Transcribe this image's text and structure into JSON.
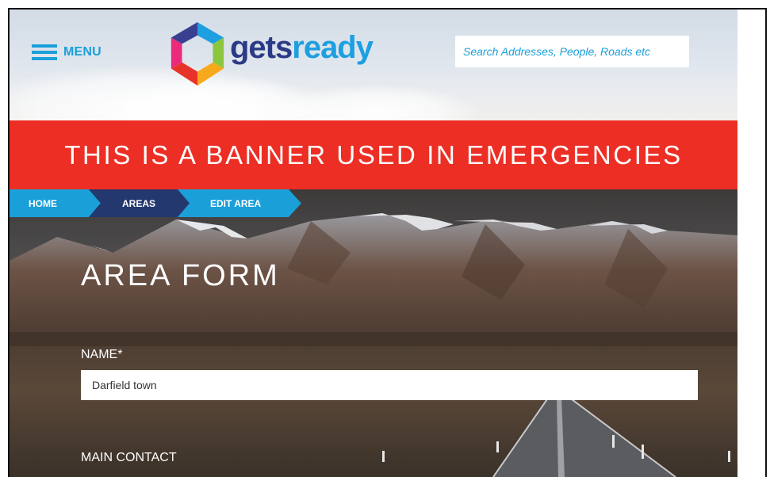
{
  "header": {
    "menu_label": "MENU",
    "logo": {
      "gets": "gets",
      "ready": "ready",
      "brand_colors": {
        "gets": "#2b3a85",
        "ready": "#1d9fe0",
        "hexagon_segments": [
          "#1d9fe0",
          "#8cc63f",
          "#f7a81b",
          "#e8332a",
          "#ec2a7c",
          "#3b3f8f"
        ]
      }
    },
    "search": {
      "placeholder": "Search Addresses, People, Roads etc"
    }
  },
  "banner": {
    "text": "THIS IS A BANNER USED IN EMERGENCIES",
    "color": "#ed2e24"
  },
  "breadcrumb": {
    "items": [
      {
        "label": "HOME",
        "color": "#1a9fd9"
      },
      {
        "label": "AREAS",
        "color": "#23386e"
      },
      {
        "label": "EDIT AREA",
        "color": "#1a9fd9"
      }
    ]
  },
  "form": {
    "title": "AREA FORM",
    "fields": [
      {
        "label": "NAME*",
        "value": "Darfield town"
      },
      {
        "label": "MAIN CONTACT"
      }
    ]
  },
  "icons": {
    "menu": "hamburger-icon",
    "logo": "hexagon-logo-icon"
  }
}
